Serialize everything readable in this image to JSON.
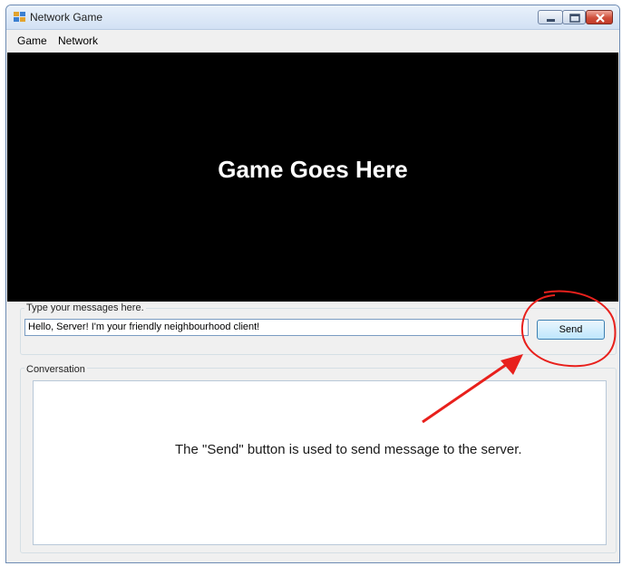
{
  "window": {
    "title": "Network Game",
    "icon": "windows-forms-app-icon",
    "controls": [
      "minimize-icon",
      "maximize-icon",
      "close-icon"
    ]
  },
  "menu": {
    "items": [
      {
        "label": "Game"
      },
      {
        "label": "Network"
      }
    ]
  },
  "game_area": {
    "placeholder": "Game Goes Here",
    "background": "#000000"
  },
  "message_panel": {
    "label": "Type your messages here.",
    "input_value": "Hello, Server! I'm your friendly neighbourhood client!",
    "send_label": "Send"
  },
  "conversation": {
    "label": "Conversation"
  },
  "annotation": {
    "text": "The \"Send\" button is used to send message to the server.",
    "color": "#e8201c"
  }
}
